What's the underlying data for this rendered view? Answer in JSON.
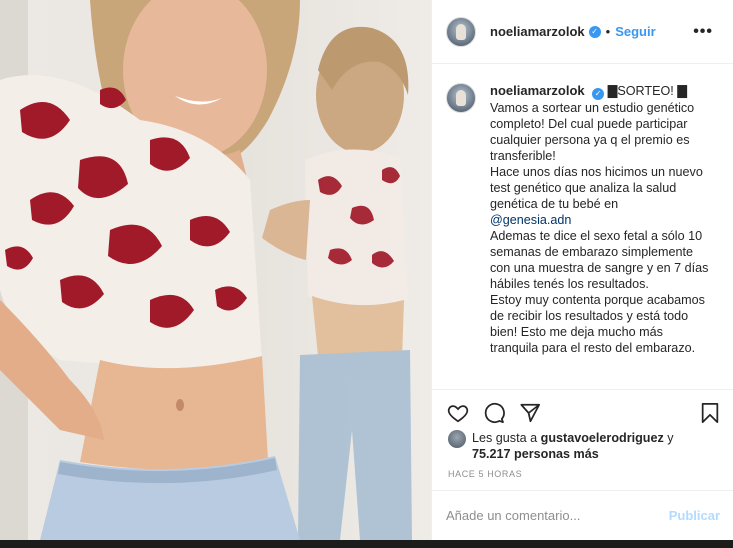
{
  "post": {
    "username": "noeliamarzolok",
    "verified_icon": "verified-badge-icon",
    "separator": "•",
    "follow_label": "Seguir",
    "more_icon": "more-options-icon",
    "more_label": "•••"
  },
  "caption": {
    "username": "noeliamarzolok",
    "lines": [
      "▇SORTEO! ▇",
      "Vamos a sortear un estudio genético completo! Del cual puede participar cualquier persona ya q el premio es transferible!",
      "Hace unos días nos hicimos un nuevo test genético que analiza la salud genética de tu bebé en",
      "@genesia.adn",
      "Ademas te dice el sexo fetal a sólo 10 semanas de embarazo simplemente con una muestra de sangre y en 7 días hábiles tenés los resultados.",
      "Estoy muy contenta porque acabamos de recibir los resultados y está todo bien! Esto me deja mucho más tranquila para el resto del embarazo."
    ]
  },
  "actions": {
    "icons": [
      "heart-icon",
      "comment-icon",
      "share-icon",
      "bookmark-icon"
    ]
  },
  "likes": {
    "prefix": "Les gusta a",
    "user": "gustavoelerodriguez",
    "connector": "y",
    "count": "75.217 personas más"
  },
  "timestamp": "HACE 5 HORAS",
  "comment": {
    "placeholder": "Añade un comentario...",
    "post_label": "Publicar"
  },
  "colors": {
    "accent": "#3897f0",
    "link": "#003569",
    "muted": "#8e8e8e",
    "post_disabled": "#b3dbff",
    "print_red": "#a11a2a"
  }
}
